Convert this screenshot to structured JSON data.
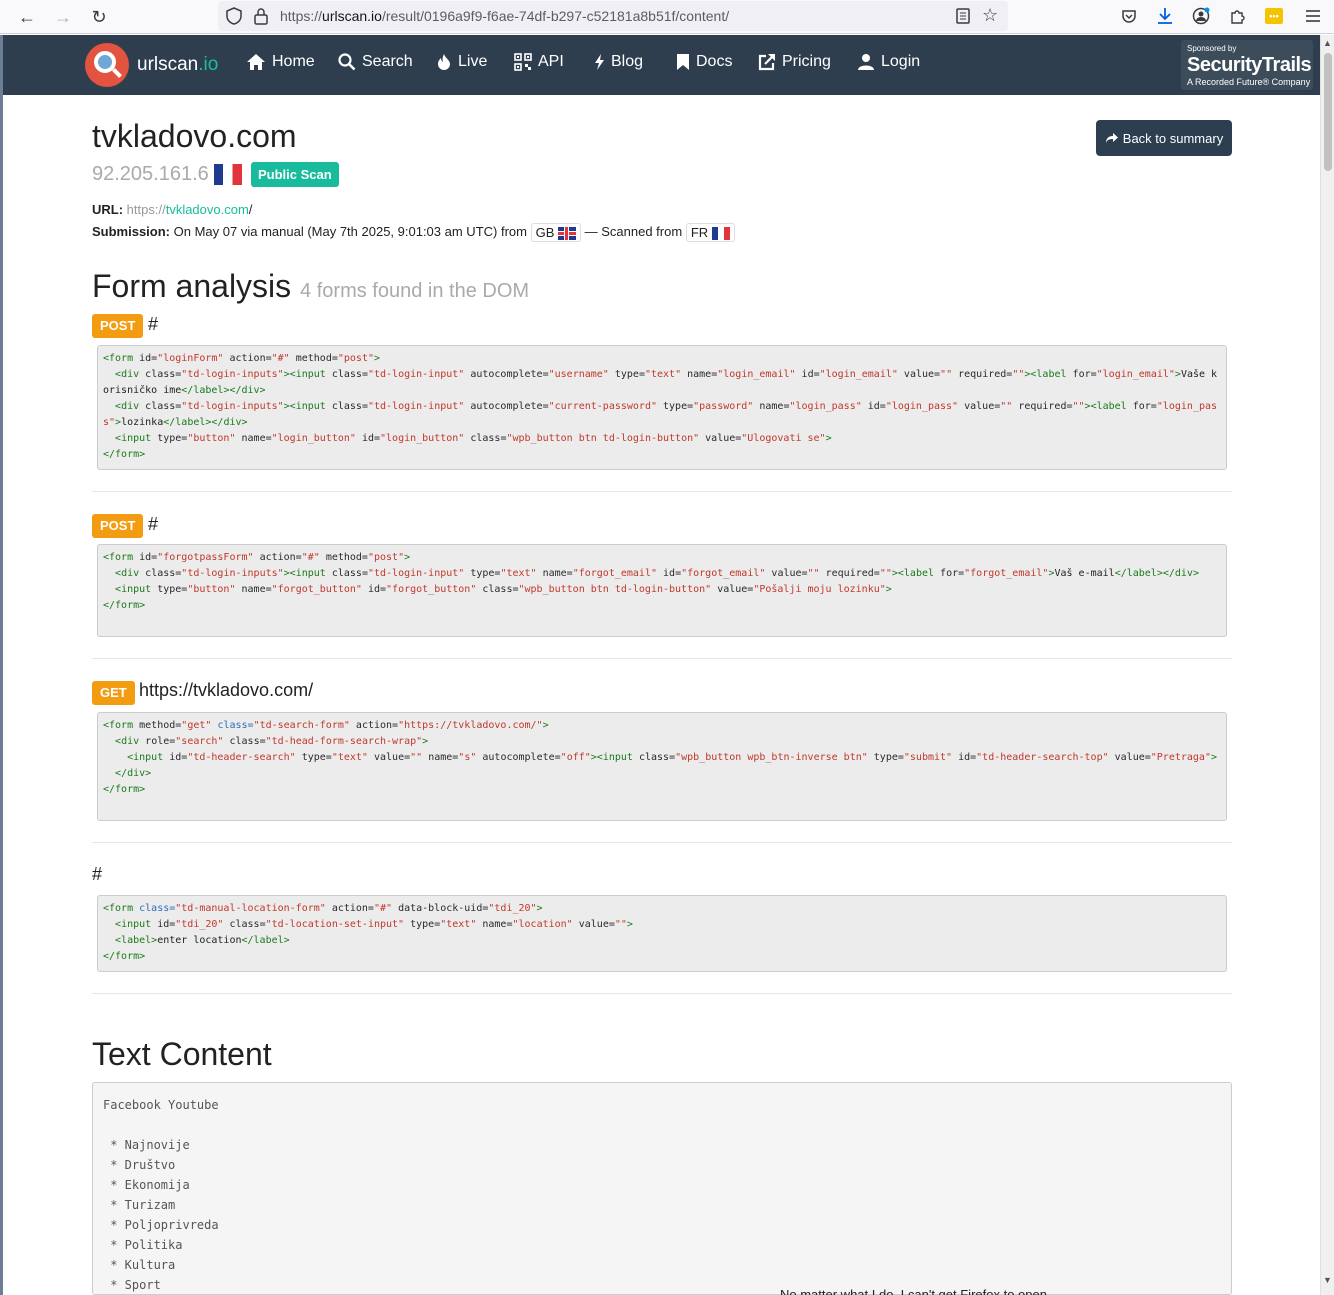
{
  "browser": {
    "url_prefix": "https://",
    "url_host": "urlscan.io",
    "url_path": "/result/0196a9f9-f6ae-74df-b297-c52181a8b51f/content/"
  },
  "nav": {
    "brand_main": "urlscan",
    "brand_suffix": ".io",
    "items": [
      {
        "icon": "home-icon",
        "label": "Home"
      },
      {
        "icon": "search-icon",
        "label": "Search"
      },
      {
        "icon": "fire-icon",
        "label": "Live"
      },
      {
        "icon": "qrcode-icon",
        "label": "API"
      },
      {
        "icon": "bolt-icon",
        "label": "Blog"
      },
      {
        "icon": "bookmark-icon",
        "label": "Docs"
      },
      {
        "icon": "external-link-icon",
        "label": "Pricing"
      },
      {
        "icon": "user-icon",
        "label": "Login"
      }
    ],
    "sponsor_line1": "Sponsored by",
    "sponsor_line2": "SecurityTrails",
    "sponsor_line3": "A Recorded Future® Company"
  },
  "header": {
    "title": "tvkladovo.com",
    "ip": "92.205.161.6",
    "badge": "Public Scan",
    "back_label": "Back to summary",
    "url_label": "URL:",
    "url_scheme": "https://",
    "url_domain": "tvkladovo.com",
    "url_rest": "/",
    "submission_label": "Submission:",
    "submission_text": "On May 07 via manual (May 7th 2025, 9:01:03 am UTC) from",
    "from_cc": "GB",
    "scanned_text": "— Scanned from",
    "scanned_cc": "FR"
  },
  "forms_section": {
    "title": "Form analysis",
    "subtitle": "4 forms found in the DOM",
    "forms": [
      {
        "method": "POST",
        "action": "#"
      },
      {
        "method": "POST",
        "action": "#"
      },
      {
        "method": "GET",
        "action": "https://tvkladovo.com/"
      },
      {
        "method": "",
        "action": "#"
      }
    ]
  },
  "text_section": {
    "title": "Text Content",
    "content": "Facebook Youtube\n\n * Najnovije\n * Društvo\n * Ekonomija\n * Turizam\n * Poljoprivreda\n * Politika\n * Kultura\n * Sport"
  },
  "footer_ghost": "No matter what I do, I can't get Firefox to open"
}
